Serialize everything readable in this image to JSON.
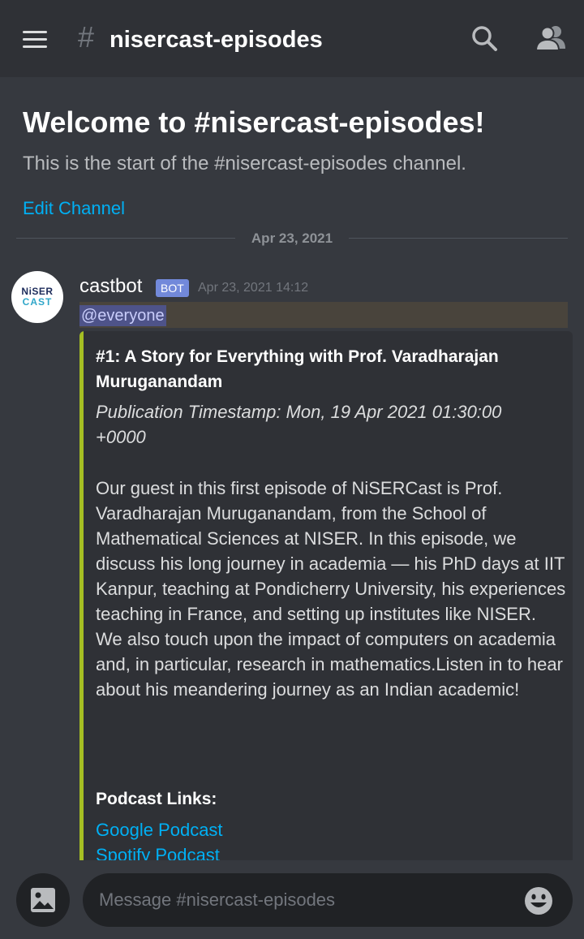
{
  "header": {
    "channel_name": "nisercast-episodes"
  },
  "welcome": {
    "title": "Welcome to #nisercast-episodes!",
    "subtitle": "This is the start of the #nisercast-episodes channel.",
    "edit_channel": "Edit Channel"
  },
  "divider": {
    "date": "Apr 23, 2021"
  },
  "message": {
    "avatar_line1": "NiSER",
    "avatar_line2": "CAST",
    "author": "castbot",
    "tag": "BOT",
    "timestamp": "Apr 23, 2021 14:12",
    "mention": "@everyone",
    "embed": {
      "accent_color": "#a5be23",
      "title": "#1: A Story for Everything with Prof. Varadharajan Muruganandam",
      "publication": "Publication Timestamp: Mon, 19 Apr 2021 01:30:00 +0000",
      "description": "Our guest in this first episode of NiSERCast is Prof. Varadharajan Muruganandam, from the School of Mathematical Sciences at NISER. In this episode, we discuss his long journey in academia — his PhD days at IIT Kanpur, teaching at Pondicherry University, his experiences teaching in France, and setting up institutes like NISER. We also touch upon the impact of computers on academia and, in particular, research in mathematics.Listen in to hear about his meandering journey as an Indian academic!",
      "links_heading": "Podcast Links:",
      "link_google": "Google Podcast",
      "link_spotify": "Spotify Podcast"
    }
  },
  "composer": {
    "placeholder": "Message #nisercast-episodes"
  },
  "icons": {
    "menu": "hamburger-icon",
    "hash": "hash-icon",
    "search": "search-icon",
    "members": "members-icon",
    "attach": "image-icon",
    "emoji": "emoji-icon"
  }
}
